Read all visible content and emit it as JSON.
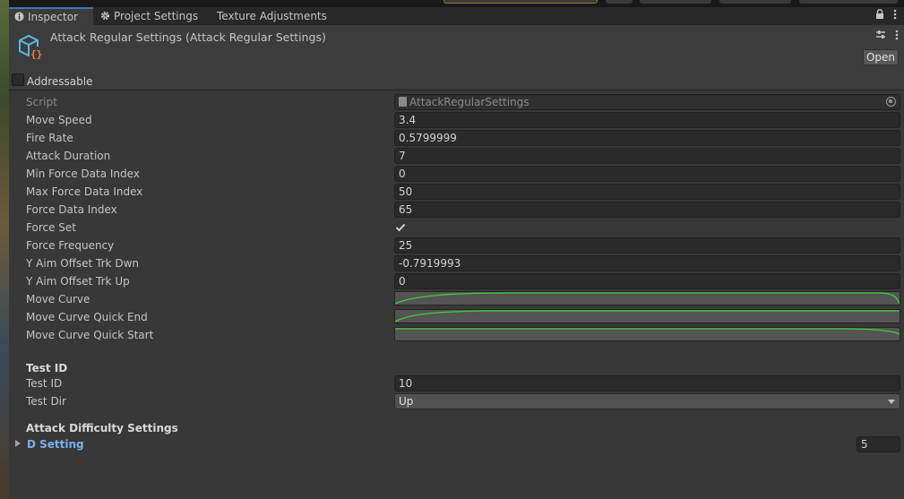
{
  "tabs": [
    {
      "label": "Inspector",
      "icon": "info-icon",
      "active": true
    },
    {
      "label": "Project Settings",
      "icon": "gear-icon",
      "active": false
    },
    {
      "label": "Texture Adjustments",
      "icon": "",
      "active": false
    }
  ],
  "header": {
    "title": "Attack Regular Settings (Attack Regular Settings)",
    "open_label": "Open",
    "addressable_label": "Addressable"
  },
  "script_field": {
    "label": "Script",
    "value": "AttackRegularSettings"
  },
  "fields": {
    "move_speed": {
      "label": "Move Speed",
      "value": "3.4"
    },
    "fire_rate": {
      "label": "Fire Rate",
      "value": "0.5799999"
    },
    "attack_duration": {
      "label": "Attack Duration",
      "value": "7"
    },
    "min_force_data_index": {
      "label": "Min Force Data Index",
      "value": "0"
    },
    "max_force_data_index": {
      "label": "Max Force Data Index",
      "value": "50"
    },
    "force_data_index": {
      "label": "Force Data Index",
      "value": "65"
    },
    "force_set": {
      "label": "Force Set",
      "checked": true
    },
    "force_frequency": {
      "label": "Force Frequency",
      "value": "25"
    },
    "y_aim_offset_trk_dwn": {
      "label": "Y Aim Offset Trk Dwn",
      "value": "-0.7919993"
    },
    "y_aim_offset_trk_up": {
      "label": "Y Aim Offset Trk Up",
      "value": "0"
    },
    "move_curve": {
      "label": "Move Curve"
    },
    "move_curve_quick_end": {
      "label": "Move Curve Quick End"
    },
    "move_curve_quick_start": {
      "label": "Move Curve Quick Start"
    }
  },
  "test_section": {
    "header": "Test ID",
    "test_id": {
      "label": "Test ID",
      "value": "10"
    },
    "test_dir": {
      "label": "Test Dir",
      "value": "Up"
    }
  },
  "difficulty_section": {
    "header": "Attack Difficulty Settings",
    "d_setting": {
      "label": "D Setting",
      "size": "5"
    }
  },
  "colors": {
    "panel_bg": "#383838",
    "field_bg": "#2a2a2a",
    "curve_line": "#3ad13a",
    "foldout_label": "#7bb0e8",
    "active_tab_accent": "#3a79bb"
  }
}
